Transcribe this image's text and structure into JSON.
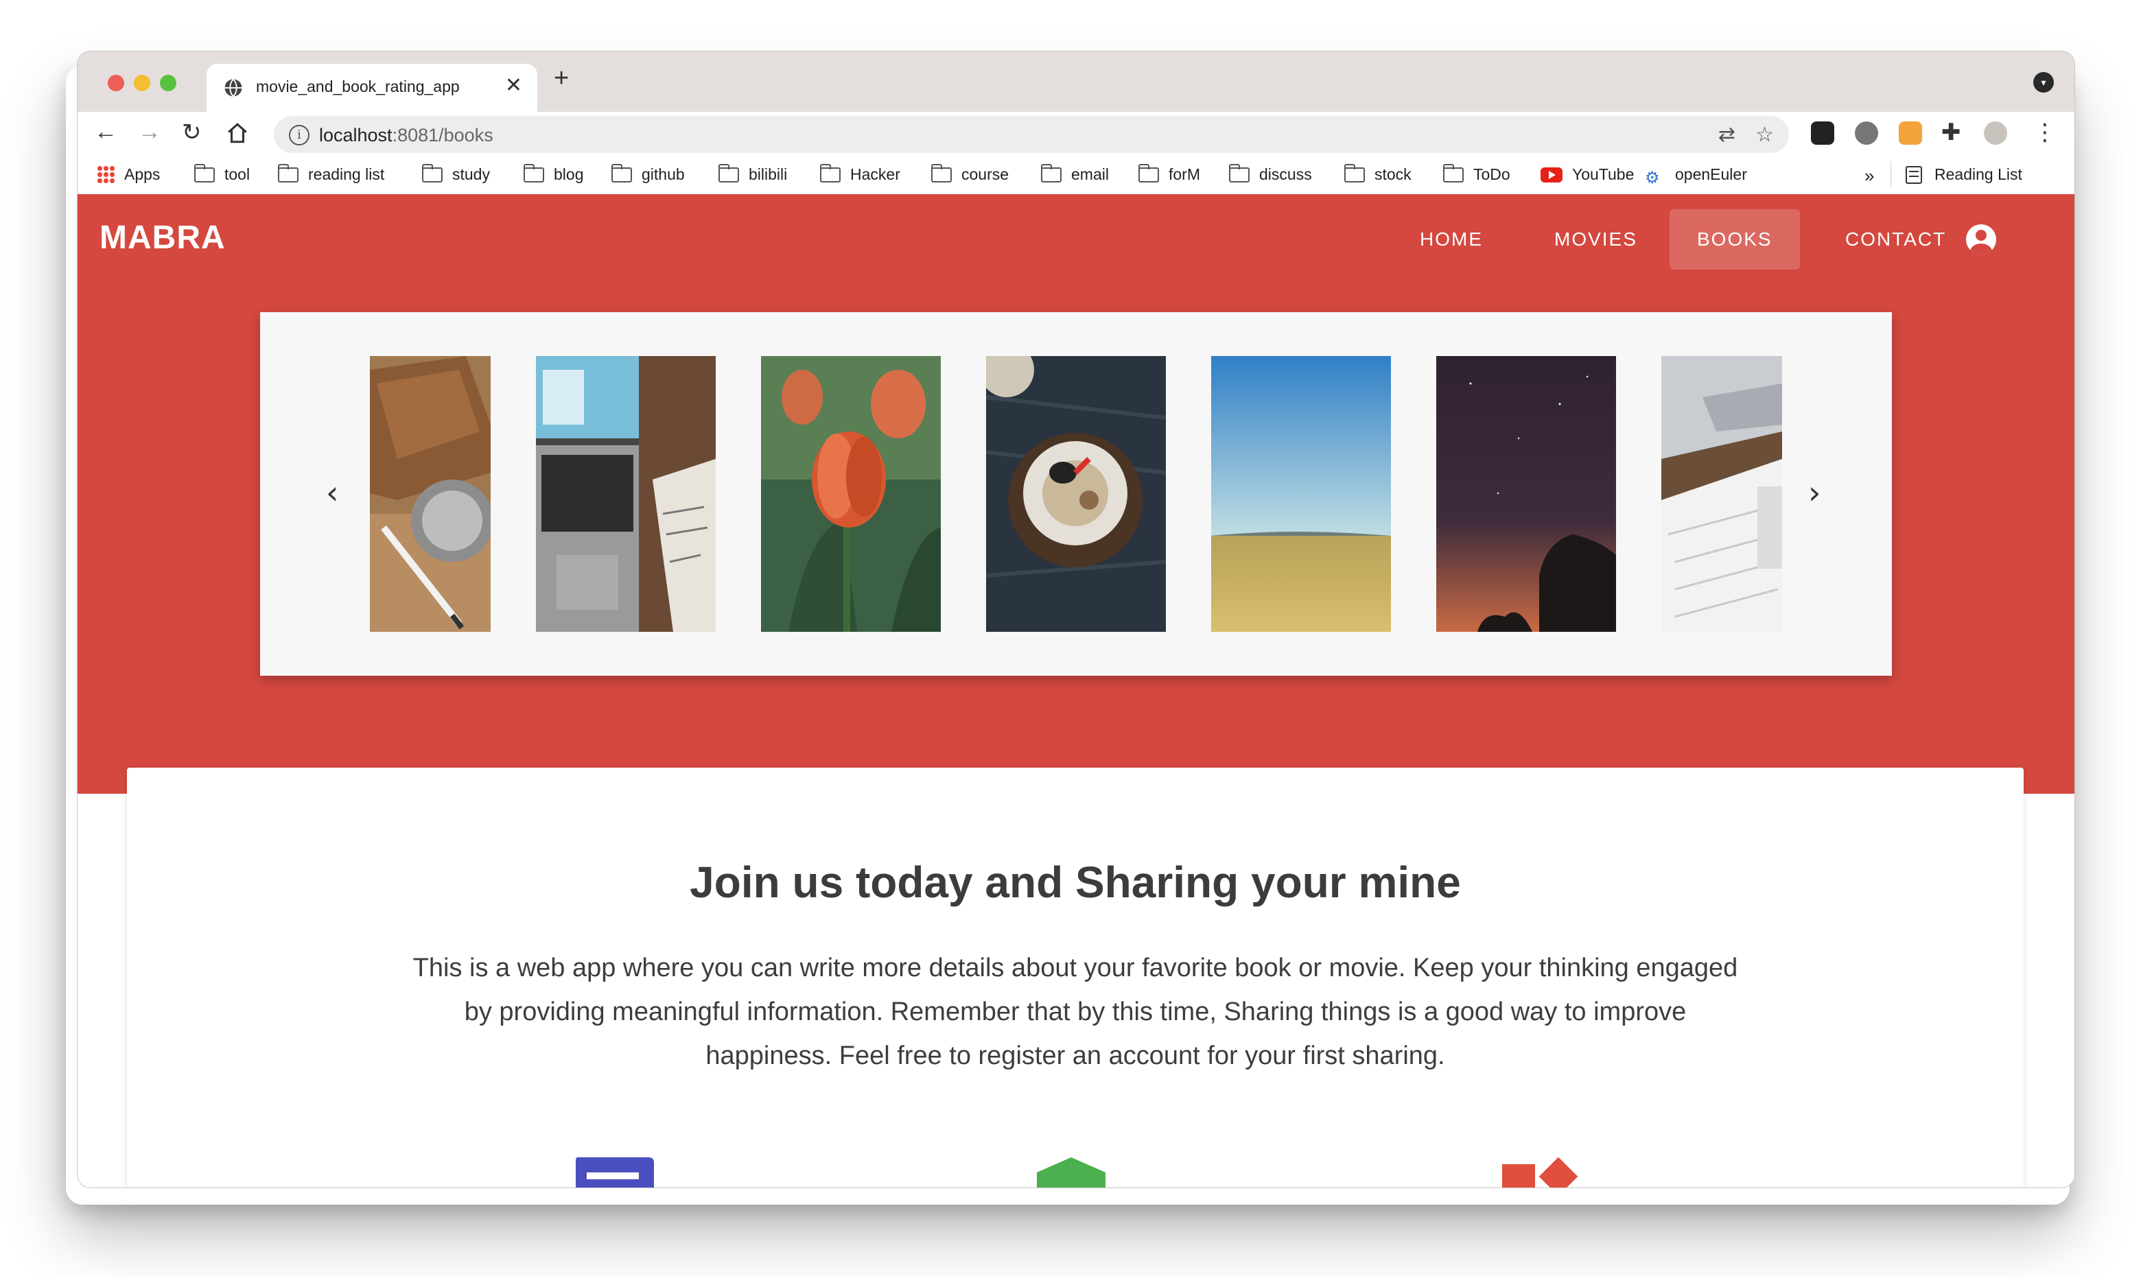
{
  "browser": {
    "tab_title": "movie_and_book_rating_app",
    "tab_close": "✕",
    "new_tab": "+",
    "url_host": "localhost",
    "url_rest": ":8081/books",
    "bookmarks": [
      {
        "label": "Apps",
        "icon": "apps-grid-icon"
      },
      {
        "label": "tool",
        "icon": "folder-icon"
      },
      {
        "label": "reading list",
        "icon": "folder-icon"
      },
      {
        "label": "study",
        "icon": "folder-icon"
      },
      {
        "label": "blog",
        "icon": "folder-icon"
      },
      {
        "label": "github",
        "icon": "folder-icon"
      },
      {
        "label": "bilibili",
        "icon": "folder-icon"
      },
      {
        "label": "Hacker",
        "icon": "folder-icon"
      },
      {
        "label": "course",
        "icon": "folder-icon"
      },
      {
        "label": "email",
        "icon": "folder-icon"
      },
      {
        "label": "forM",
        "icon": "folder-icon"
      },
      {
        "label": "discuss",
        "icon": "folder-icon"
      },
      {
        "label": "stock",
        "icon": "folder-icon"
      },
      {
        "label": "ToDo",
        "icon": "folder-icon"
      },
      {
        "label": "YouTube",
        "icon": "youtube-icon"
      },
      {
        "label": "openEuler",
        "icon": "openeuler-icon"
      }
    ],
    "bookmarks_overflow": "»",
    "reading_list": "Reading List"
  },
  "app": {
    "brand": "MABRA",
    "nav": [
      "HOME",
      "MOVIES",
      "BOOKS",
      "CONTACT"
    ],
    "active_nav": "BOOKS",
    "accent_color": "#d4483f"
  },
  "carousel": {
    "prev": "‹",
    "next": "›",
    "slides": [
      {
        "name": "leather-notebook-and-pen"
      },
      {
        "name": "laptop-and-sketch-paper"
      },
      {
        "name": "orange-tulips"
      },
      {
        "name": "dessert-bowl-on-dark-wood"
      },
      {
        "name": "wheat-field-blue-sky"
      },
      {
        "name": "night-sky-with-stars"
      },
      {
        "name": "laptop-and-calendar"
      }
    ]
  },
  "intro": {
    "title": "Join us today and Sharing your mine",
    "body": "This is a web app where you can write more details about your favorite book or movie. Keep your thinking engaged by providing meaningful information. Remember that by this time, Sharing things is a good way to improve happiness. Feel free to register an account for your first sharing."
  },
  "features": [
    {
      "icon": "chat-message-icon",
      "color": "#4a4fbf"
    },
    {
      "icon": "shield-plus-icon",
      "color": "#4caf50"
    },
    {
      "icon": "widgets-icon",
      "color": "#e04e3e"
    }
  ]
}
